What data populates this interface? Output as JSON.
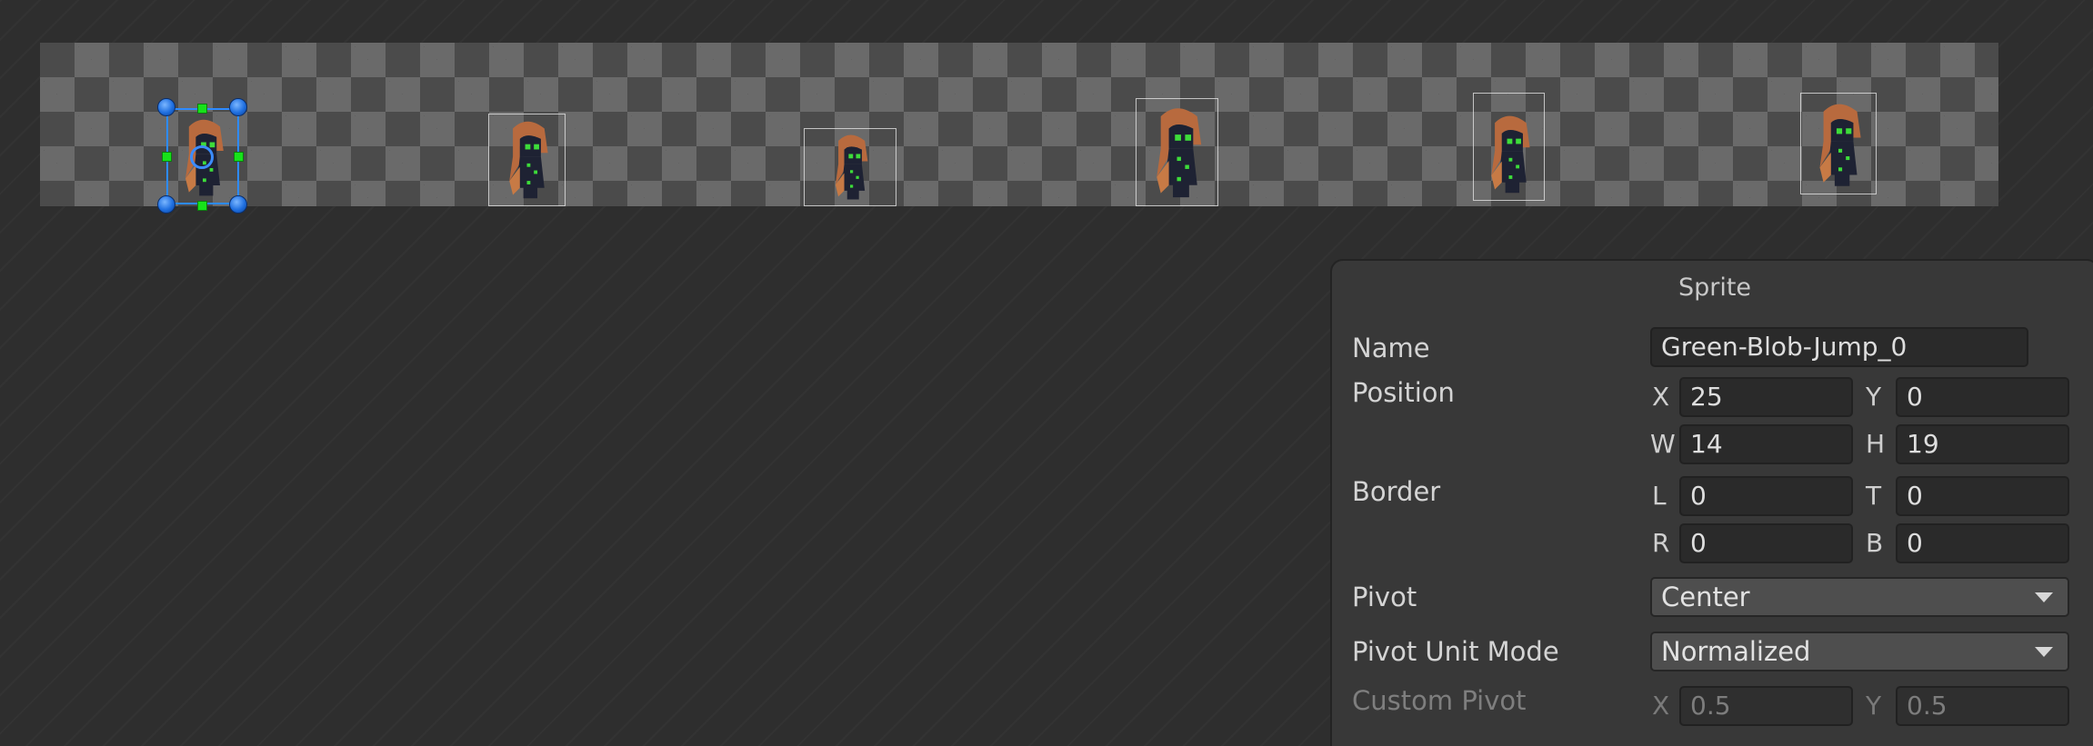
{
  "sprite_sheet": {
    "frames": [
      {
        "id": "frame-0",
        "selected": true
      },
      {
        "id": "frame-1",
        "selected": false
      },
      {
        "id": "frame-2",
        "selected": false
      },
      {
        "id": "frame-3",
        "selected": false
      },
      {
        "id": "frame-4",
        "selected": false
      },
      {
        "id": "frame-5",
        "selected": false
      }
    ],
    "colors": {
      "checker_dark": "#4b4b4b",
      "checker_light": "#6a6a6a",
      "selection": "#2d8bff",
      "edge_handle": "#17e21a"
    }
  },
  "inspector": {
    "title": "Sprite",
    "name": {
      "label": "Name",
      "value": "Green-Blob-Jump_0"
    },
    "position": {
      "label": "Position",
      "x_label": "X",
      "x": "25",
      "y_label": "Y",
      "y": "0",
      "w_label": "W",
      "w": "14",
      "h_label": "H",
      "h": "19"
    },
    "border": {
      "label": "Border",
      "l_label": "L",
      "l": "0",
      "t_label": "T",
      "t": "0",
      "r_label": "R",
      "r": "0",
      "b_label": "B",
      "b": "0"
    },
    "pivot": {
      "label": "Pivot",
      "value": "Center"
    },
    "pivot_unit_mode": {
      "label": "Pivot Unit Mode",
      "value": "Normalized"
    },
    "custom_pivot": {
      "label": "Custom Pivot",
      "x_label": "X",
      "x": "0.5",
      "y_label": "Y",
      "y": "0.5"
    }
  }
}
